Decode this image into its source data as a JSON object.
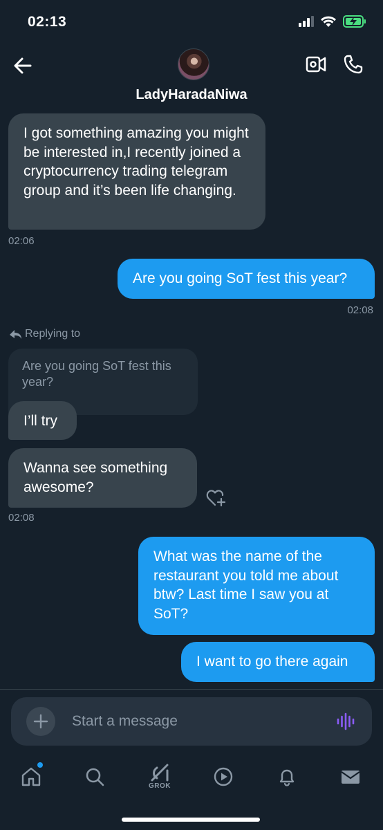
{
  "status_bar": {
    "time": "02:13"
  },
  "header": {
    "contact_name": "LadyHaradaNiwa"
  },
  "messages": [
    {
      "direction": "received",
      "text": "I got something amazing you might be interested in,I recently joined a cryptocurrency trading telegram group and it’s been life changing.",
      "time": "02:06"
    },
    {
      "direction": "sent",
      "text": "Are you going SoT fest this year?",
      "time": "02:08"
    },
    {
      "direction": "received",
      "replying_label": "Replying to",
      "quoted_text": "Are you going SoT fest this year?",
      "text": "I’ll try"
    },
    {
      "direction": "received",
      "text": "Wanna see something awesome?",
      "time": "02:08"
    },
    {
      "direction": "sent",
      "text": "What was the name of the restaurant you told me about btw? Last time I saw you at SoT?"
    },
    {
      "direction": "sent",
      "text": "I want to go there again"
    }
  ],
  "composer": {
    "placeholder": "Start a message"
  },
  "tab_bar": {
    "grok_label": "GROK",
    "home_has_notification": true
  },
  "icons": {
    "back": "arrow-left-icon",
    "video": "video-camera-icon",
    "call": "phone-icon",
    "reply": "reply-arrow-icon",
    "react": "heart-plus-icon",
    "add": "plus-icon",
    "voice": "voice-wave-icon",
    "home": "home-icon",
    "search": "search-icon",
    "grok": "grok-icon",
    "video_tab": "play-circle-icon",
    "notifications": "bell-icon",
    "messages": "mail-icon"
  },
  "colors": {
    "background": "#15202b",
    "received_bubble": "#38444d",
    "sent_bubble": "#1d9bf0",
    "muted_text": "#8b98a5",
    "voice_accent": "#8b5cf6",
    "battery": "#4ade80"
  }
}
